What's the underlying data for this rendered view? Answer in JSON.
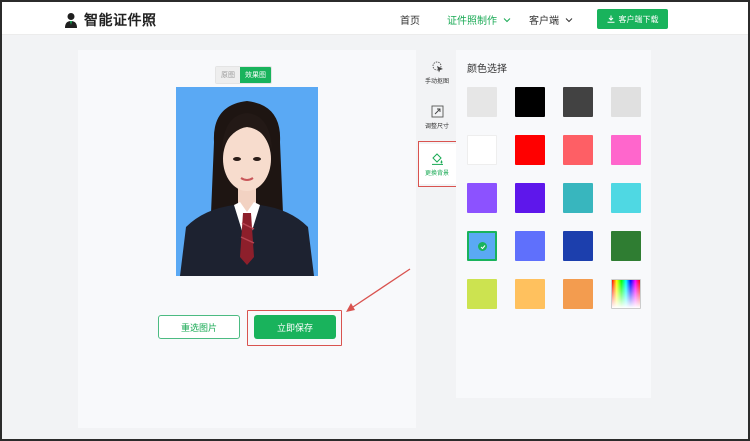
{
  "header": {
    "app_name": "智能证件照",
    "nav": [
      {
        "label": "首页"
      },
      {
        "label": "证件照制作"
      },
      {
        "label": "客户端"
      }
    ],
    "download_label": "客户端下载"
  },
  "preview": {
    "toggle_original": "原图",
    "toggle_result": "效果图",
    "background_color": "#5aa9f4"
  },
  "buttons": {
    "reselect": "重选图片",
    "save": "立即保存"
  },
  "tools": [
    {
      "label": "手动抠图",
      "icon": "cursor-magic-icon"
    },
    {
      "label": "调整尺寸",
      "icon": "resize-icon"
    },
    {
      "label": "更换背景",
      "icon": "paint-bucket-icon"
    }
  ],
  "color_panel": {
    "title": "颜色选择",
    "selected_color": "#5aa9f4",
    "swatches": [
      "#e6e6e6",
      "#000000",
      "#424242",
      "#e0e0e0",
      "#ffffff",
      "#ff0000",
      "#fe5f65",
      "#ff66cc",
      "#8c52ff",
      "#5e17eb",
      "#38b6be",
      "#4fd8e3",
      "#5aa9f4",
      "#5f70fc",
      "#1c3fad",
      "#2f7d32",
      "#cce350",
      "#ffc15e",
      "#f39c4f",
      "gradient"
    ]
  }
}
